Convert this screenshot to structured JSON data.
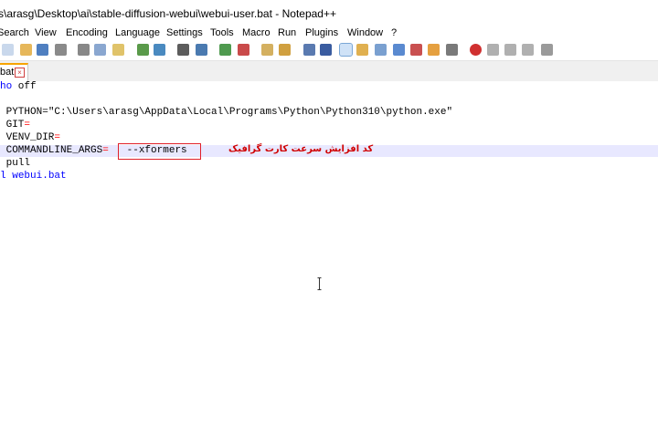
{
  "window": {
    "title": "s\\arasg\\Desktop\\ai\\stable-diffusion-webui\\webui-user.bat - Notepad++"
  },
  "menu": [
    "Search",
    "View",
    "Encoding",
    "Language",
    "Settings",
    "Tools",
    "Macro",
    "Run",
    "Plugins",
    "Window",
    "?"
  ],
  "tab": {
    "label": "bat"
  },
  "editor": {
    "lines": [
      {
        "parts": [
          {
            "cls": "kw",
            "text": "ho"
          },
          {
            "cls": "cmd",
            "text": " off"
          }
        ]
      },
      {
        "parts": []
      },
      {
        "parts": [
          {
            "cls": "cmd",
            "text": " PYTHON="
          },
          {
            "cls": "cmd",
            "text": "\"C:\\Users\\arasg\\AppData\\Local\\Programs\\Python\\Python310\\python.exe\""
          }
        ]
      },
      {
        "parts": [
          {
            "cls": "cmd",
            "text": " GIT"
          },
          {
            "cls": "op",
            "text": "="
          }
        ]
      },
      {
        "parts": [
          {
            "cls": "cmd",
            "text": " VENV_DIR"
          },
          {
            "cls": "op",
            "text": "="
          }
        ]
      },
      {
        "parts": [
          {
            "cls": "cmd",
            "text": " COMMANDLINE_ARGS"
          },
          {
            "cls": "op",
            "text": "="
          },
          {
            "cls": "cmd",
            "text": "   --xformers"
          }
        ],
        "highlight": true
      },
      {
        "parts": [
          {
            "cls": "cmd",
            "text": " pull"
          }
        ]
      },
      {
        "parts": [
          {
            "cls": "kw",
            "text": "l"
          },
          {
            "cls": "cmd",
            "text": " "
          },
          {
            "cls": "kw",
            "text": "webui.bat"
          }
        ]
      }
    ]
  },
  "annotation": {
    "text": "کد افزایش سرعت کارت گرافیک",
    "color": "#d00000"
  }
}
